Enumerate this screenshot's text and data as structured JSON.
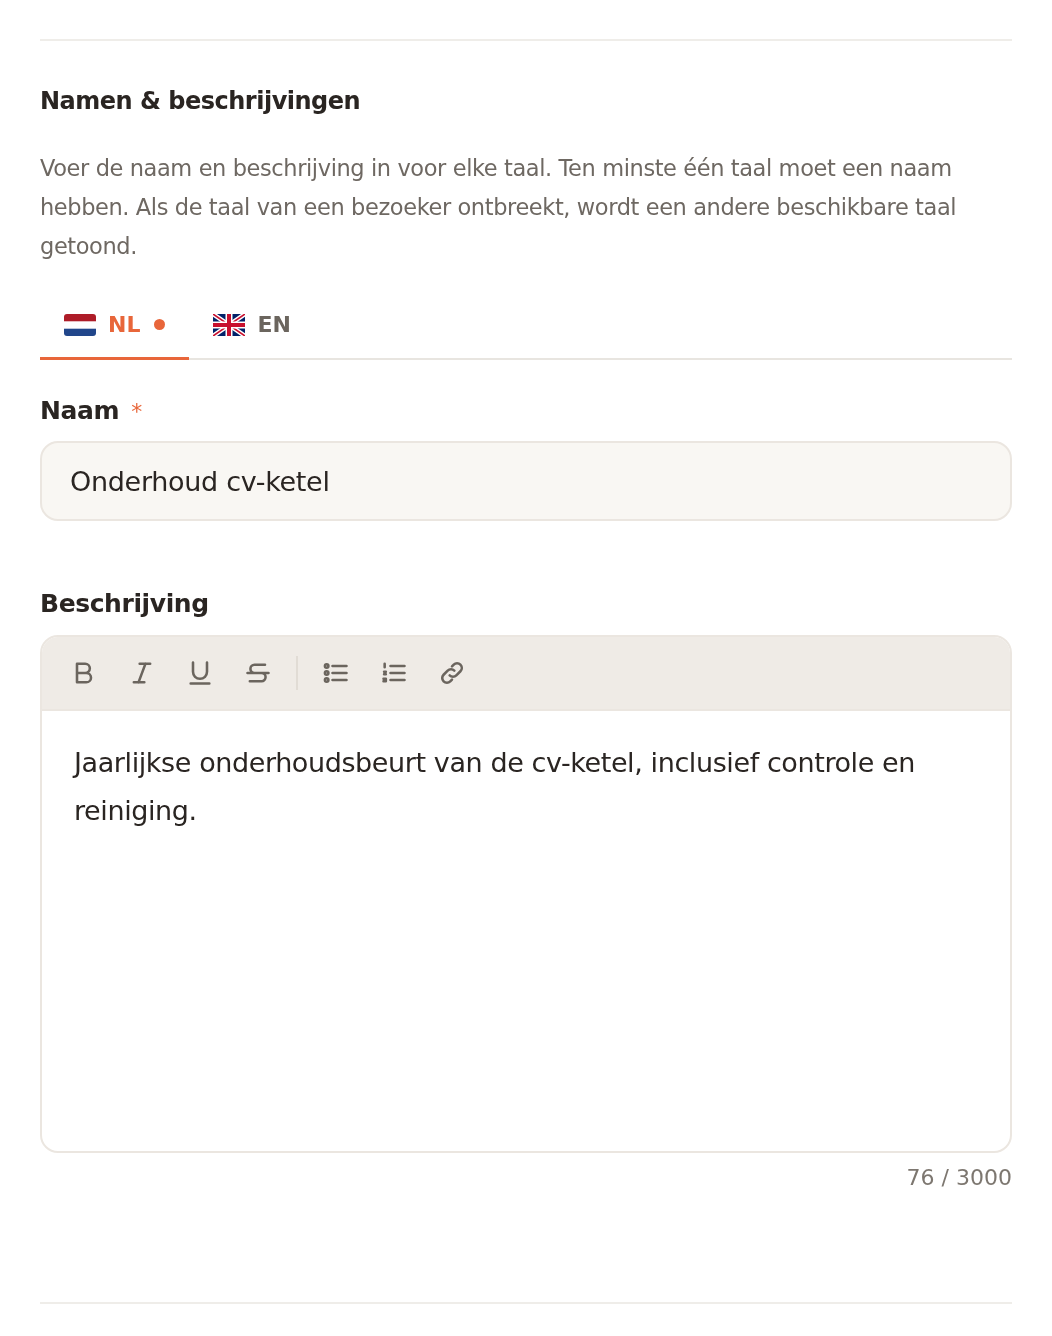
{
  "section": {
    "title": "Namen & beschrijvingen",
    "description": "Voer de naam en beschrijving in voor elke taal. Ten minste één taal moet een naam hebben. Als de taal van een bezoeker ontbreekt, wordt een andere beschikbare taal getoond."
  },
  "tabs": [
    {
      "kind": "nl",
      "label": "NL",
      "selected": true,
      "has_content": true
    },
    {
      "kind": "gb",
      "label": "EN",
      "selected": false,
      "has_content": false
    }
  ],
  "name_field": {
    "label": "Naam",
    "required_mark": "*",
    "value": "Onderhoud cv-ketel"
  },
  "description_field": {
    "label": "Beschrijving",
    "toolbar": [
      {
        "kind": "bold"
      },
      {
        "kind": "italic"
      },
      {
        "kind": "underline"
      },
      {
        "kind": "strike"
      },
      {
        "kind": "divider"
      },
      {
        "kind": "bullets"
      },
      {
        "kind": "numbers"
      },
      {
        "kind": "link"
      }
    ],
    "value": "Jaarlijkse onderhoudsbeurt van de cv-ketel, inclusief controle en reiniging.",
    "counter": "76 / 3000"
  }
}
